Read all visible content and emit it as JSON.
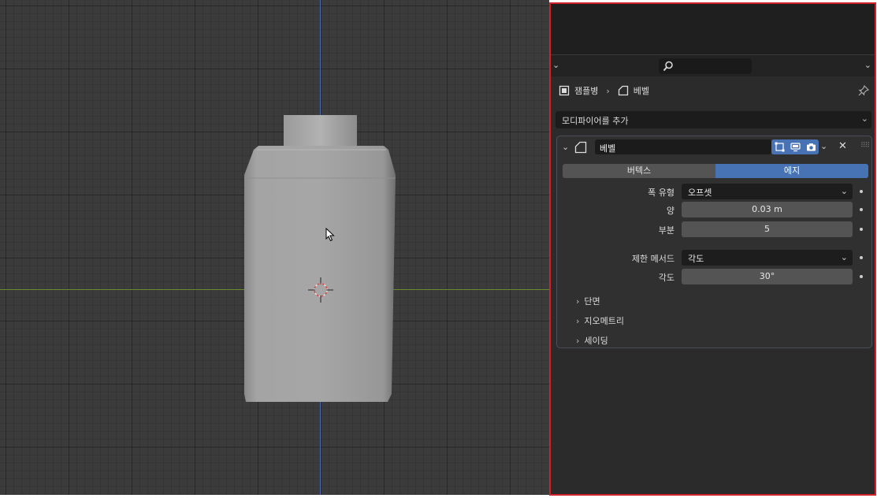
{
  "breadcrumb": {
    "object_name": "잼플병",
    "modifier_name": "베벨"
  },
  "add_modifier": {
    "label": "모디파이어를 추가"
  },
  "modifier": {
    "name": "베벨",
    "tabs": [
      {
        "label": "버텍스",
        "active": false
      },
      {
        "label": "에지",
        "active": true
      }
    ],
    "properties": {
      "width_type": {
        "label": "폭 유형",
        "value": "오프셋"
      },
      "amount": {
        "label": "양",
        "value": "0.03 m"
      },
      "segments": {
        "label": "부분",
        "value": "5"
      },
      "limit_method": {
        "label": "제한 메서드",
        "value": "각도"
      },
      "angle": {
        "label": "각도",
        "value": "30°"
      }
    },
    "subpanels": [
      {
        "label": "단면"
      },
      {
        "label": "지오메트리"
      },
      {
        "label": "세이딩"
      }
    ]
  },
  "colors": {
    "accent": "#4772b3",
    "highlight_border": "#d4202a",
    "viewport_bg": "#3b3b3b",
    "panel_bg": "#2b2b2b"
  },
  "icons": [
    "search-icon",
    "object-icon",
    "bevel-modifier-icon",
    "pin-icon",
    "edit-mode-icon",
    "viewport-display-icon",
    "render-camera-icon",
    "close-icon",
    "3d-cursor-icon",
    "mouse-pointer-icon"
  ]
}
